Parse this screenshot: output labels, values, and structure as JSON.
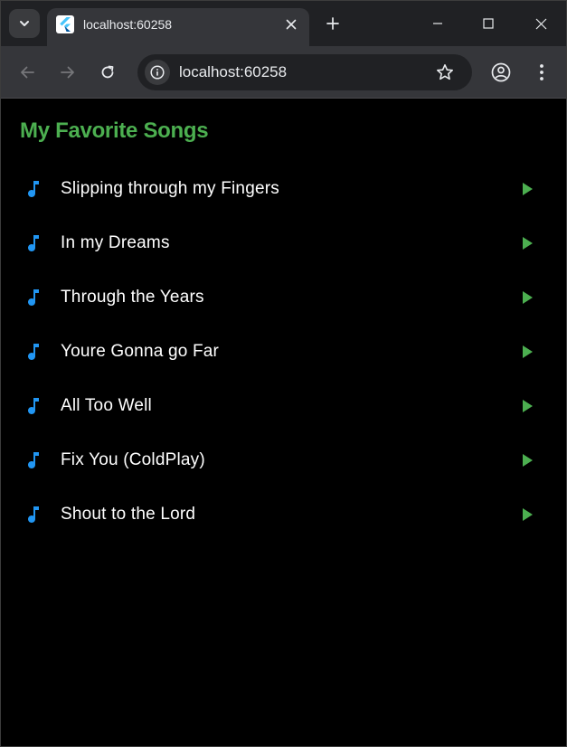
{
  "browser": {
    "tab": {
      "title": "localhost:60258"
    },
    "address": {
      "url": "localhost:60258"
    }
  },
  "colors": {
    "title": "#4caf50",
    "note_icon": "#2196f3",
    "play_icon": "#4caf50"
  },
  "app": {
    "title": "My Favorite Songs",
    "songs": [
      {
        "title": "Slipping through my Fingers"
      },
      {
        "title": "In my Dreams"
      },
      {
        "title": "Through the Years"
      },
      {
        "title": "Youre Gonna go Far"
      },
      {
        "title": "All Too Well"
      },
      {
        "title": "Fix You (ColdPlay)"
      },
      {
        "title": "Shout to the Lord"
      }
    ]
  },
  "icons": {
    "song_leading": "music-note-icon",
    "song_trailing": "play-arrow-icon"
  }
}
